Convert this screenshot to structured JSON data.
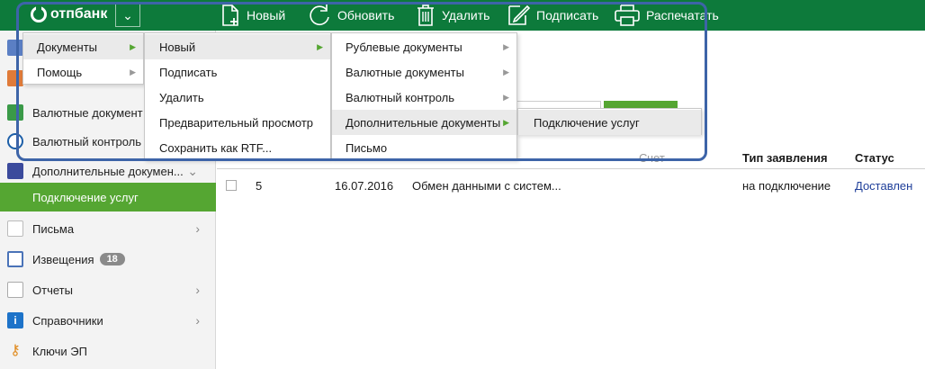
{
  "brand": {
    "name": "отпбанк"
  },
  "toolbar": {
    "new_label": "Новый",
    "refresh_label": "Обновить",
    "delete_label": "Удалить",
    "sign_label": "Подписать",
    "print_label": "Распечатать"
  },
  "sidebar": {
    "items": [
      {
        "label": "Валютные документ"
      },
      {
        "label": "Валютный контроль"
      },
      {
        "label": "Дополнительные докумен..."
      },
      {
        "label": "Подключение услуг"
      },
      {
        "label": "Письма"
      },
      {
        "label": "Извещения",
        "badge": "18"
      },
      {
        "label": "Отчеты"
      },
      {
        "label": "Справочники"
      },
      {
        "label": "Ключи ЭП"
      }
    ]
  },
  "menu_main": {
    "items": [
      {
        "label": "Документы"
      },
      {
        "label": "Помощь"
      }
    ]
  },
  "menu_documents": {
    "items": [
      {
        "label": "Новый"
      },
      {
        "label": "Подписать"
      },
      {
        "label": "Удалить"
      },
      {
        "label": "Предварительный просмотр"
      },
      {
        "label": "Сохранить как RTF..."
      }
    ]
  },
  "menu_new": {
    "items": [
      {
        "label": "Рублевые документы"
      },
      {
        "label": "Валютные документы"
      },
      {
        "label": "Валютный контроль"
      },
      {
        "label": "Дополнительные документы"
      },
      {
        "label": "Письмо"
      }
    ]
  },
  "menu_additional": {
    "items": [
      {
        "label": "Подключение услуг"
      }
    ]
  },
  "table": {
    "columns": {
      "account": "Счет",
      "request_type": "Тип заявления",
      "status": "Статус"
    },
    "rows": [
      {
        "number": "5",
        "date": "16.07.2016",
        "description": "Обмен данными с систем...",
        "request_type": "на подключение",
        "status": "Доставлен"
      }
    ]
  },
  "colors": {
    "brand_green": "#0d7a3b",
    "accent_green": "#55a632",
    "status_blue": "#1f3f9a",
    "frame_blue": "#3d64a8"
  }
}
